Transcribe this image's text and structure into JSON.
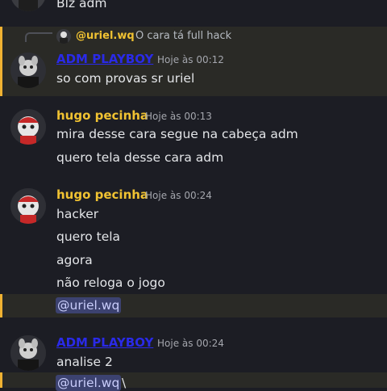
{
  "top_message": {
    "text": "Blz adm"
  },
  "reply_preview": {
    "author": "@uriel.wq",
    "text": "O cara tá full hack"
  },
  "messages": [
    {
      "author": "ADM PLAYBOY",
      "timestamp": "Hoje às 00:12",
      "lines": [
        "so com provas sr uriel"
      ]
    },
    {
      "author": "hugo pecinha",
      "timestamp": "Hoje às 00:13",
      "lines": [
        "mira desse cara segue na cabeça adm",
        "quero tela desse cara adm"
      ]
    },
    {
      "author": "hugo pecinha",
      "timestamp": "Hoje às 00:24",
      "lines": [
        "hacker",
        "quero tela",
        "agora",
        "não reloga o jogo"
      ],
      "mention": "@uriel.wq"
    },
    {
      "author": "ADM PLAYBOY",
      "timestamp": "Hoje às 00:24",
      "lines": [
        "analise 2"
      ],
      "mention": "@uriel.wq",
      "mention_suffix": "\\"
    }
  ],
  "colors": {
    "background": "#1c1d24",
    "highlight_bg": "#2a2a26",
    "highlight_bar": "#f0b232",
    "adm_name": "#2a2ae8",
    "hugo_name": "#f0c232",
    "mention_bg": "#3c4270"
  }
}
